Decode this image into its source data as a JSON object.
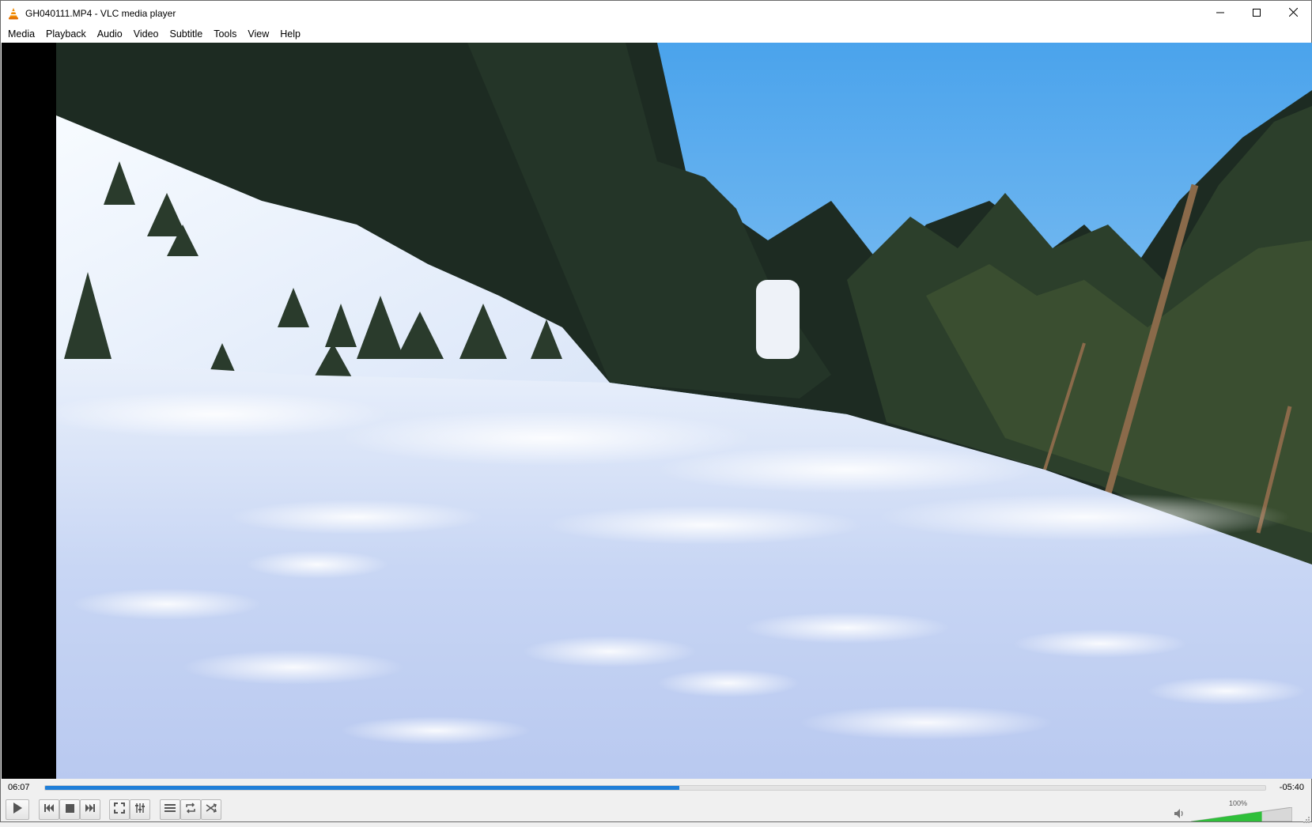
{
  "window": {
    "title": "GH040111.MP4 - VLC media player"
  },
  "menu": [
    "Media",
    "Playback",
    "Audio",
    "Video",
    "Subtitle",
    "Tools",
    "View",
    "Help"
  ],
  "player": {
    "elapsed": "06:07",
    "remaining": "-05:40",
    "progress_fraction": 0.52,
    "volume_label": "100%",
    "volume_fraction": 0.7
  },
  "icons": {
    "app": "vlc-cone-icon",
    "minimize": "minimize-icon",
    "maximize": "maximize-icon",
    "close": "close-icon",
    "play": "play-icon",
    "prev": "previous-icon",
    "stop": "stop-icon",
    "next": "next-icon",
    "fullscreen": "fullscreen-icon",
    "extended": "extended-settings-icon",
    "playlist": "playlist-icon",
    "loop": "loop-icon",
    "random": "shuffle-icon",
    "mute": "speaker-icon"
  },
  "colors": {
    "accent": "#1f7ed8",
    "volume": "#2fbf3a"
  }
}
